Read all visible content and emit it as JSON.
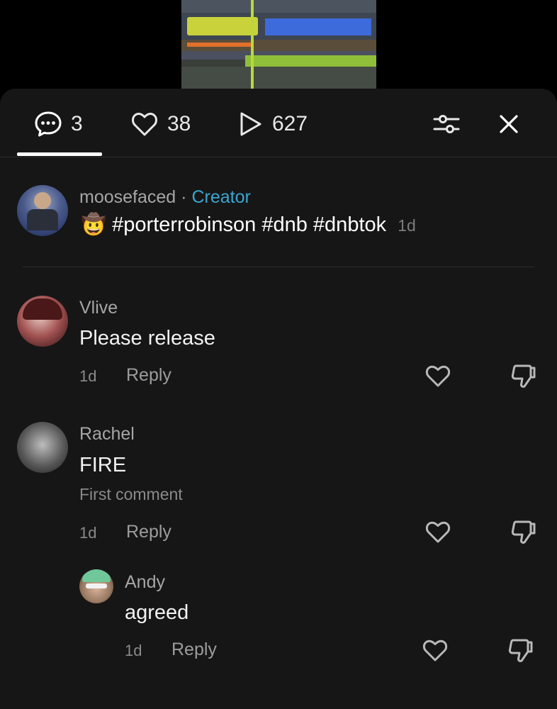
{
  "tabs": {
    "comments_count": "3",
    "likes_count": "38",
    "views_count": "627"
  },
  "creator_post": {
    "username": "moosefaced",
    "separator": "·",
    "badge": "Creator",
    "emoji": "🤠",
    "caption": "#porterrobinson #dnb #dnbtok",
    "age": "1d"
  },
  "comments": [
    {
      "username": "Vlive",
      "text": "Please release",
      "age": "1d",
      "reply_label": "Reply"
    },
    {
      "username": "Rachel",
      "text": "FIRE",
      "note": "First comment",
      "age": "1d",
      "reply_label": "Reply"
    },
    {
      "username": "Andy",
      "text": "agreed",
      "age": "1d",
      "reply_label": "Reply"
    }
  ],
  "colors": {
    "sheet_bg": "#161616",
    "creator_badge": "#3aa6d0",
    "muted_text": "#a6a6a6"
  },
  "icons": [
    "comment-icon",
    "heart-icon",
    "play-icon",
    "filter-sliders-icon",
    "close-icon",
    "like-heart-icon",
    "dislike-icon"
  ]
}
